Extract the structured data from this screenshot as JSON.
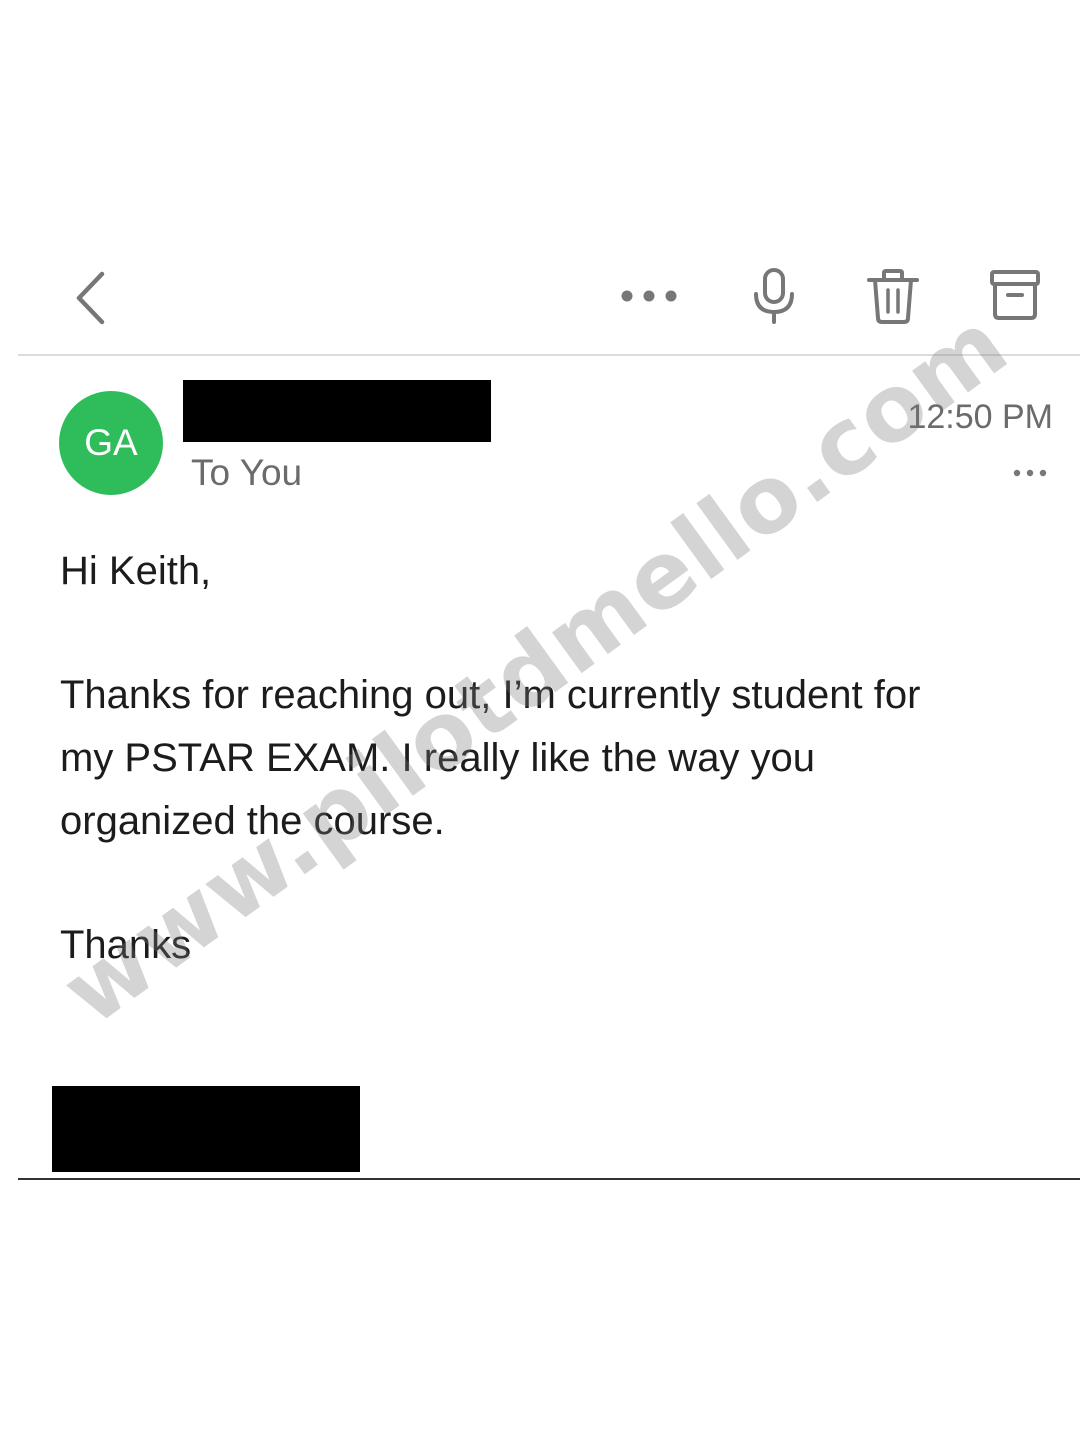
{
  "toolbar": {
    "icons": [
      "back-chevron-icon",
      "more-horizontal-icon",
      "microphone-icon",
      "trash-icon",
      "archive-icon"
    ]
  },
  "message": {
    "avatar_initials": "GA",
    "avatar_color": "#2fbd5c",
    "recipient_line": "To You",
    "time": "12:50 PM",
    "greeting": "Hi Keith,",
    "body_lines": [
      "Thanks for reaching out, I’m currently student for",
      "my PSTAR EXAM. I really like the way you",
      "organized the course."
    ],
    "signoff": "Thanks"
  },
  "watermark": "www.pilotdmello.com"
}
